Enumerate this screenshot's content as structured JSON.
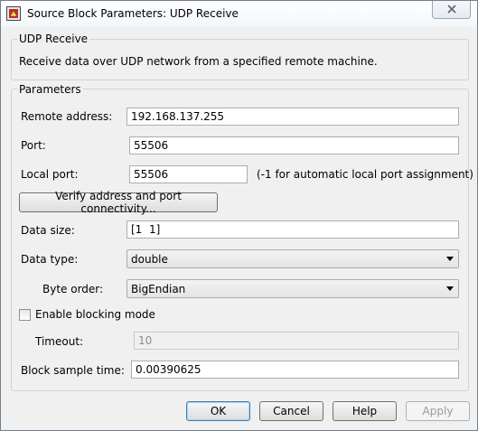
{
  "window": {
    "title": "Source Block Parameters: UDP Receive"
  },
  "block": {
    "group_title": "UDP Receive",
    "description": "Receive data over UDP network from a specified remote machine."
  },
  "params": {
    "group_title": "Parameters",
    "remote_address": {
      "label": "Remote address:",
      "value": "192.168.137.255"
    },
    "port": {
      "label": "Port:",
      "value": "55506"
    },
    "local_port": {
      "label": "Local port:",
      "value": "55506",
      "hint": "(-1 for automatic local port assignment)"
    },
    "verify_button": "Verify address and port connectivity...",
    "data_size": {
      "label": "Data size:",
      "value": "[1  1]"
    },
    "data_type": {
      "label": "Data type:",
      "value": "double"
    },
    "byte_order": {
      "label": "Byte order:",
      "value": "BigEndian"
    },
    "blocking": {
      "label": "Enable blocking mode",
      "checked": false
    },
    "timeout": {
      "label": "Timeout:",
      "value": "10"
    },
    "sample_time": {
      "label": "Block sample time:",
      "value": "0.00390625"
    }
  },
  "buttons": {
    "ok": "OK",
    "cancel": "Cancel",
    "help": "Help",
    "apply": "Apply"
  },
  "icons": {
    "app": "simulink-block-icon",
    "close": "close-icon",
    "dropdown": "chevron-down-icon"
  }
}
